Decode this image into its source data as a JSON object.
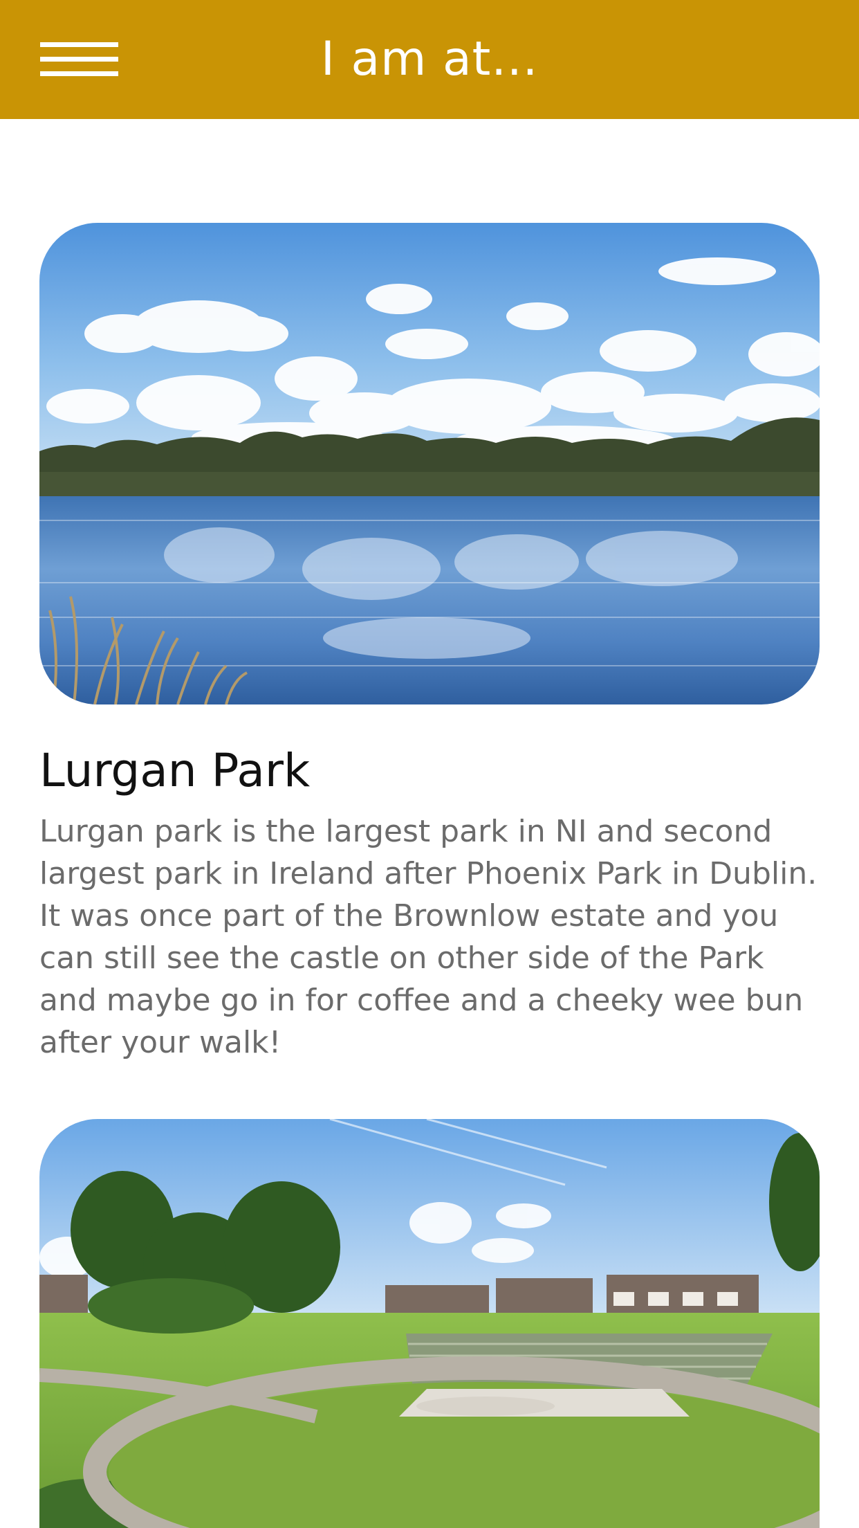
{
  "header": {
    "title": "I am at...",
    "menu_icon": "hamburger-menu-icon",
    "background_color": "#C99405"
  },
  "places": [
    {
      "name": "Lurgan Park",
      "description": "Lurgan park is the largest park in NI and second largest park in Ireland after Phoenix Park in Dublin. It was once part of the Brownlow estate and you can still see the castle on other side of the Park and maybe go in for coffee and a cheeky wee bun after your walk!",
      "image": "lake-with-clouds-photo"
    },
    {
      "name": "",
      "description": "",
      "image": "park-amphitheatre-photo"
    }
  ]
}
